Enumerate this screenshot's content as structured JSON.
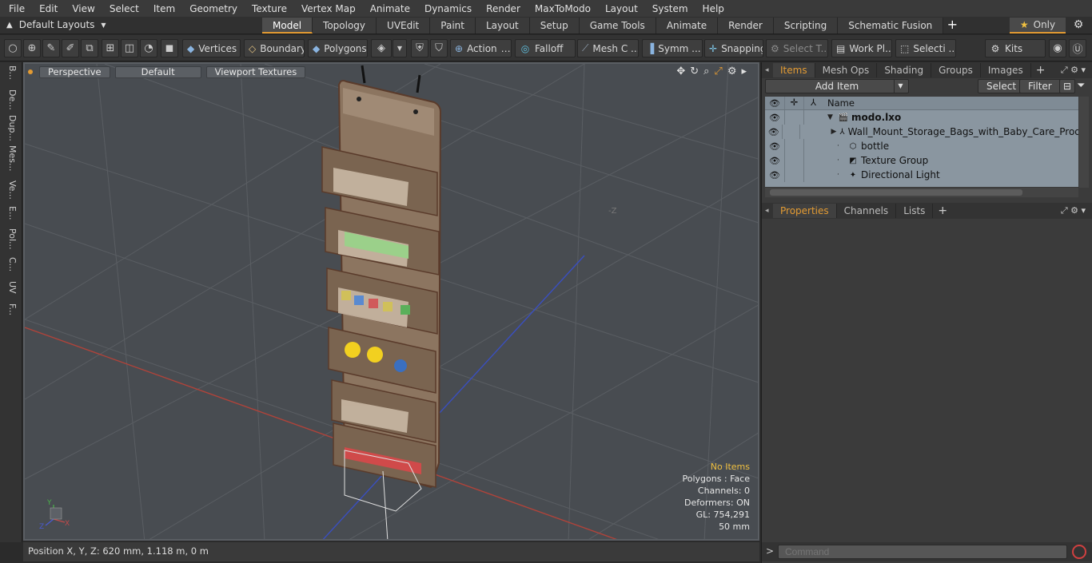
{
  "menu": [
    "File",
    "Edit",
    "View",
    "Select",
    "Item",
    "Geometry",
    "Texture",
    "Vertex Map",
    "Animate",
    "Dynamics",
    "Render",
    "MaxToModo",
    "Layout",
    "System",
    "Help"
  ],
  "layout": {
    "label": "Default Layouts",
    "tabs": [
      "Model",
      "Topology",
      "UVEdit",
      "Paint",
      "Layout",
      "Setup",
      "Game Tools",
      "Animate",
      "Render",
      "Scripting",
      "Schematic Fusion"
    ],
    "active_tab": "Model",
    "plus": "+",
    "only_label": "Only"
  },
  "toolbar": {
    "vertices": "Vertices",
    "boundary": "Boundary",
    "polygons": "Polygons",
    "action": "Action",
    "falloff": "Falloff",
    "meshc": "Mesh C ...",
    "symm": "Symm ...",
    "snapping": "Snapping",
    "selectt": "Select T...",
    "workpl": "Work Pl...",
    "selecti": "Selecti ...",
    "kits": "Kits"
  },
  "left_tabs": [
    "B...",
    "De...",
    "Dup...",
    "Mes...",
    "Ve...",
    "E...",
    "Pol...",
    "C...",
    "UV",
    "F..."
  ],
  "viewport": {
    "perspective": "Perspective",
    "default": "Default",
    "textures": "Viewport Textures",
    "axis_label": "-Z",
    "info": {
      "no_items": "No Items",
      "polygons": "Polygons : Face",
      "channels": "Channels: 0",
      "deformers": "Deformers: ON",
      "gl": "GL: 754,291",
      "scale": "50 mm"
    }
  },
  "status": "Position X, Y, Z:   620 mm, 1.118 m, 0 m",
  "items_panel": {
    "tabs": [
      "Items",
      "Mesh Ops",
      "Shading",
      "Groups",
      "Images"
    ],
    "active_tab": "Items",
    "add_item": "Add Item",
    "select": "Select",
    "filter": "Filter",
    "name_header": "Name",
    "rows": [
      {
        "name": "modo.lxo",
        "indent": 0
      },
      {
        "name": "Wall_Mount_Storage_Bags_with_Baby_Care_Products",
        "indent": 1
      },
      {
        "name": "bottle",
        "indent": 1
      },
      {
        "name": "Texture Group",
        "indent": 1
      },
      {
        "name": "Directional Light",
        "indent": 1
      }
    ]
  },
  "props_panel": {
    "tabs": [
      "Properties",
      "Channels",
      "Lists"
    ],
    "active_tab": "Properties"
  },
  "command": {
    "placeholder": "Command",
    "arrow": ">"
  },
  "colors": {
    "accent": "#e39b33",
    "grid": "#565a5f",
    "x_axis": "#c0392b",
    "z_axis": "#3a4fc0",
    "wood": "#8c7560"
  }
}
